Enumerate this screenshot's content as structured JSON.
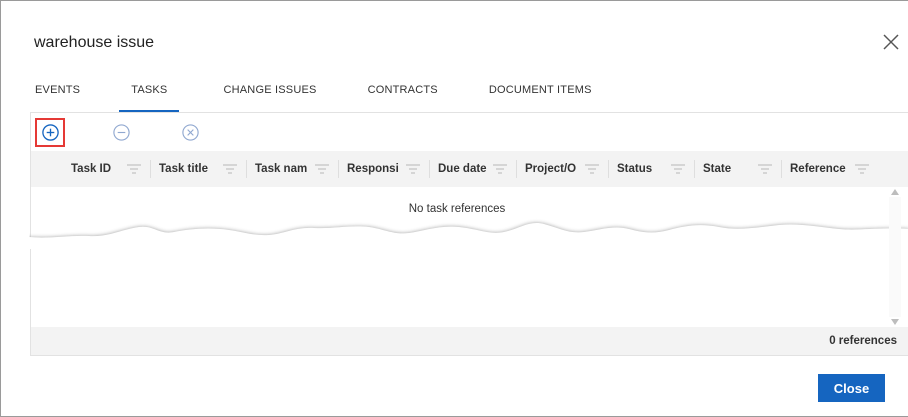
{
  "dialog": {
    "title": "warehouse issue",
    "close_icon": "close-icon"
  },
  "tabs": [
    {
      "label": "EVENTS",
      "active": false
    },
    {
      "label": "TASKS",
      "active": true
    },
    {
      "label": "CHANGE ISSUES",
      "active": false
    },
    {
      "label": "CONTRACTS",
      "active": false
    },
    {
      "label": "DOCUMENT ITEMS",
      "active": false
    }
  ],
  "toolbar": {
    "add_icon": "add-circle-icon",
    "remove_icon": "remove-circle-icon",
    "delete_icon": "cancel-circle-icon"
  },
  "table": {
    "columns": [
      {
        "label": "Task ID"
      },
      {
        "label": "Task title"
      },
      {
        "label": "Task nam"
      },
      {
        "label": "Responsil"
      },
      {
        "label": "Due date"
      },
      {
        "label": "Project/O"
      },
      {
        "label": "Status"
      },
      {
        "label": "State"
      },
      {
        "label": "Reference"
      }
    ],
    "empty_message": "No task references",
    "reference_count": "0 references"
  },
  "footer": {
    "close_label": "Close"
  },
  "colors": {
    "accent": "#1565c0",
    "highlight": "#e53935",
    "header_bg": "#f3f3f3"
  }
}
